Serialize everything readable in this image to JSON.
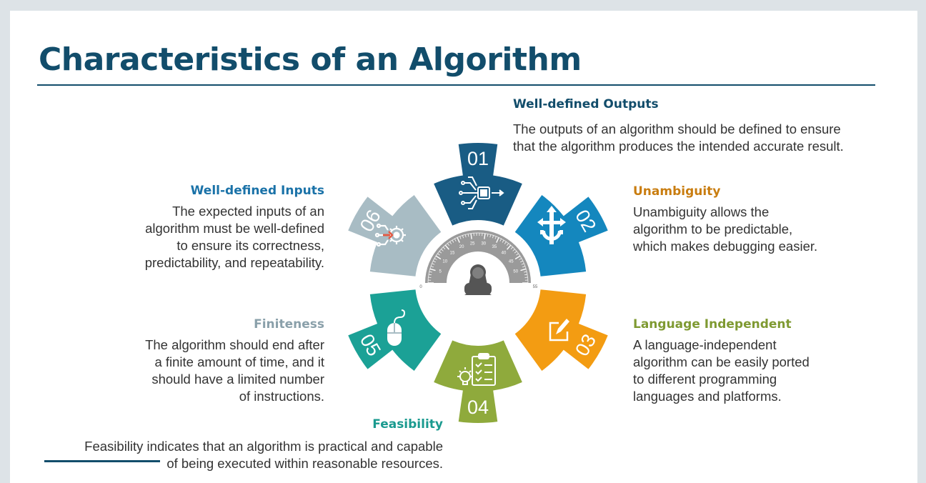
{
  "title": "Characteristics of an Algorithm",
  "items": [
    {
      "number": "01",
      "heading": "Well-defined Inputs",
      "lines": [
        "The expected inputs of an",
        "algorithm must be well-defined",
        "to ensure its correctness,",
        "predictability, and repeatability."
      ],
      "color": "#195c84",
      "icon": "circuit-gear-icon"
    },
    {
      "number": "02",
      "heading": "Well-defined Outputs",
      "lines": [
        "The outputs of an algorithm should be defined to ensure",
        "that the algorithm produces the intended accurate result."
      ],
      "color": "#1487be",
      "icon": "chip-output-icon"
    },
    {
      "number": "03",
      "heading": "Unambiguity",
      "lines": [
        "Unambiguity allows the",
        "algorithm to be predictable,",
        "which makes debugging easier."
      ],
      "color": "#f39c12",
      "icon": "gear-arrows-icon"
    },
    {
      "number": "04",
      "heading": "Language Independent",
      "lines": [
        "A language-independent",
        "algorithm can be easily ported",
        "to different programming",
        "languages and platforms."
      ],
      "color": "#8faa3c",
      "icon": "edit-icon"
    },
    {
      "number": "05",
      "heading": "Feasibility",
      "lines": [
        "Feasibility indicates that an algorithm is practical and capable",
        "of being executed within reasonable resources."
      ],
      "color": "#1ba196",
      "icon": "checklist-bulb-icon"
    },
    {
      "number": "06",
      "heading": "Finiteness",
      "lines": [
        "The algorithm should end after",
        "a finite amount of time, and it",
        "should have a limited number",
        "of instructions."
      ],
      "color": "#a8bcc4",
      "icon": "mouse-icon"
    }
  ],
  "gauge": {
    "ticks": [
      "0",
      "5",
      "10",
      "15",
      "20",
      "25",
      "30",
      "35",
      "40",
      "45",
      "50",
      "55"
    ]
  },
  "colors": {
    "title": "#124d6b",
    "text": "#333333",
    "gauge": "#9a9a9a"
  }
}
